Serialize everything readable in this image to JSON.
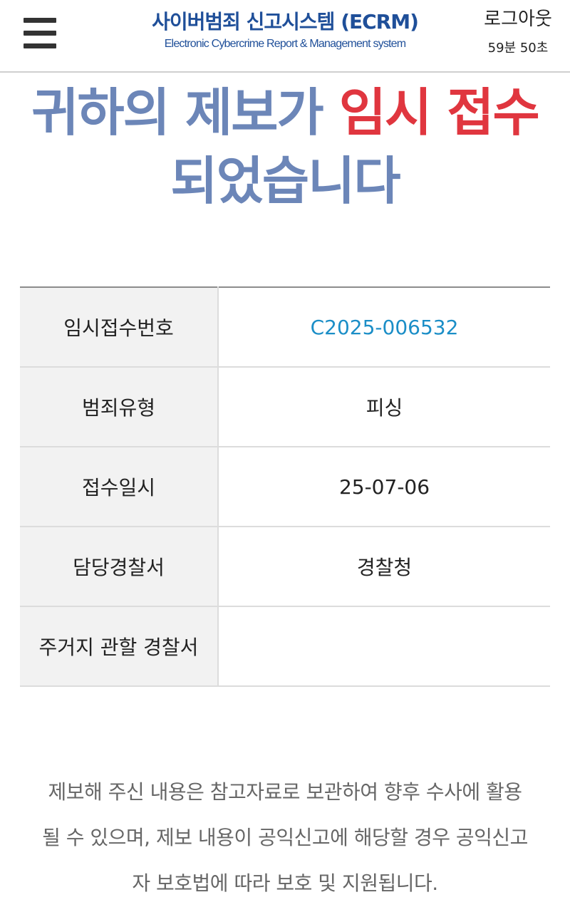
{
  "header": {
    "title": "사이버범죄 신고시스템 (ECRM)",
    "subtitle": "Electronic Cybercrime Report & Management system",
    "logout_label": "로그아웃",
    "session_timer": "59분 50초",
    "menu_icon": "hamburger-menu-icon"
  },
  "headline": {
    "line1_prefix": "귀하의 제보가 ",
    "line1_highlight": "임시 접수",
    "line2": "되었습니다",
    "highlight_color": "#e0363f",
    "text_color": "#6c86b8"
  },
  "info_table": {
    "rows": [
      {
        "label": "임시접수번호",
        "value": "C2025-006532"
      },
      {
        "label": "범죄유형",
        "value": "피싱"
      },
      {
        "label": "접수일시",
        "value": "25-07-06"
      },
      {
        "label": "담당경찰서",
        "value": "경찰청"
      },
      {
        "label": "주거지 관할 경찰서",
        "value": ""
      }
    ],
    "receipt_color": "#1b8ec7"
  },
  "notice": {
    "line1": "제보해 주신 내용은 참고자료로 보관하여 향후 수사에 활용",
    "line2": "될 수 있으며, 제보 내용이 공익신고에 해당할 경우 공익신고",
    "line3": "자 보호법에 따라 보호 및 지원됩니다."
  }
}
